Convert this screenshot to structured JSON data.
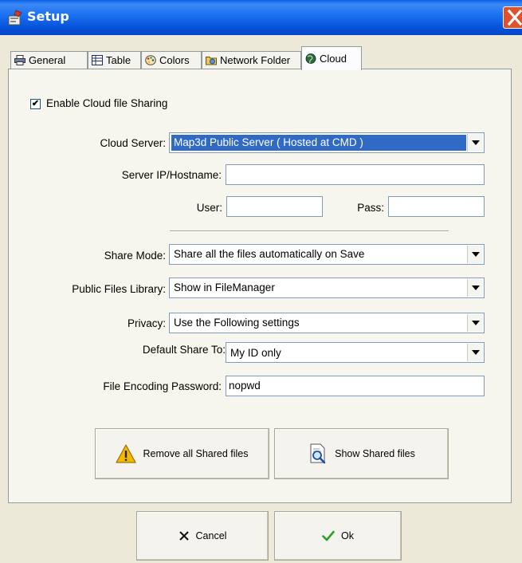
{
  "window": {
    "title": "Setup"
  },
  "tabs": [
    {
      "label": "General",
      "icon": "printer-icon"
    },
    {
      "label": "Table",
      "icon": "table-icon"
    },
    {
      "label": "Colors",
      "icon": "palette-icon"
    },
    {
      "label": "Network Folder",
      "icon": "network-folder-icon"
    },
    {
      "label": "Cloud",
      "icon": "globe-icon",
      "active": true
    }
  ],
  "cloud": {
    "enable_sharing": {
      "label": "Enable Cloud file Sharing",
      "checked": true
    },
    "cloud_server": {
      "label": "Cloud Server:",
      "value": "Map3d Public Server  ( Hosted at CMD )"
    },
    "server_ip": {
      "label": "Server IP/Hostname:",
      "value": ""
    },
    "user": {
      "label": "User:",
      "value": ""
    },
    "pass": {
      "label": "Pass:",
      "value": ""
    },
    "share_mode": {
      "label": "Share Mode:",
      "value": "Share all the files automatically on Save"
    },
    "public_library": {
      "label": "Public Files Library:",
      "value": "Show in FileManager"
    },
    "privacy": {
      "label": "Privacy:",
      "value": "Use the Following settings"
    },
    "default_share_to": {
      "label": "Default Share To:",
      "value": "My ID only"
    },
    "encoding_password": {
      "label": "File Encoding Password:",
      "value": "nopwd"
    },
    "remove_shared_label": "Remove all Shared files",
    "show_shared_label": "Show Shared files"
  },
  "footer": {
    "cancel_label": "Cancel",
    "ok_label": "Ok"
  },
  "colors": {
    "titlebar": "#0a5fe6",
    "selection": "#316ac5",
    "warning": "#f5b800",
    "ok_check": "#2aa02a"
  }
}
